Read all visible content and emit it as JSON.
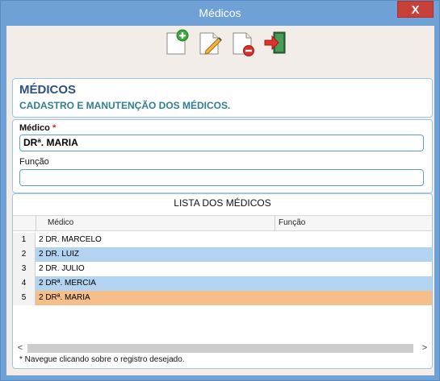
{
  "window": {
    "title": "Médicos",
    "close_label": "X"
  },
  "toolbar": {
    "buttons": [
      {
        "icon": "new-document-icon"
      },
      {
        "icon": "edit-document-icon"
      },
      {
        "icon": "delete-document-icon"
      },
      {
        "icon": "exit-icon"
      }
    ]
  },
  "header": {
    "title": "MÉDICOS",
    "subtitle": "CADASTRO E MANUTENÇÃO DOS MÉDICOS."
  },
  "form": {
    "medico_label": "Médico",
    "required_mark": "*",
    "medico_value": "DRª. MARIA",
    "funcao_label": "Função",
    "funcao_value": ""
  },
  "list": {
    "title": "LISTA DOS MÉDICOS",
    "columns": [
      "Médico",
      "Função"
    ],
    "rows": [
      {
        "num": "1",
        "medico": "2 DR. MARCELO",
        "funcao": ""
      },
      {
        "num": "2",
        "medico": "2 DR. LUIZ",
        "funcao": ""
      },
      {
        "num": "3",
        "medico": "2 DR. JULIO",
        "funcao": ""
      },
      {
        "num": "4",
        "medico": "2 DRª. MERCIA",
        "funcao": ""
      },
      {
        "num": "5",
        "medico": "2 DRª. MARIA",
        "funcao": ""
      }
    ],
    "scroll_left": "<",
    "scroll_right": ">",
    "footnote": "* Navegue clicando sobre o registro desejado."
  },
  "colors": {
    "titlebar": "#6fa0d6",
    "close": "#c7413a",
    "row_alt": "#b3d3f1",
    "row_selected": "#f6be8b",
    "header_title": "#2f4f86",
    "header_subtitle": "#2f7f8f"
  }
}
